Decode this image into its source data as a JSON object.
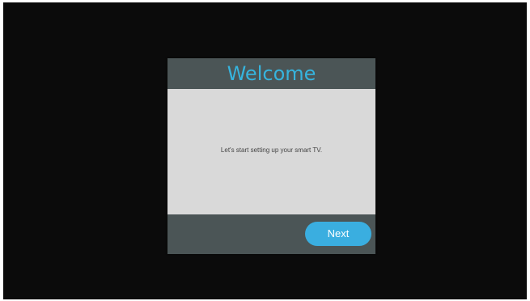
{
  "dialog": {
    "title": "Welcome",
    "message": "Let's start setting up your smart TV.",
    "next_label": "Next"
  },
  "colors": {
    "accent": "#36b4de",
    "button": "#3aaee0",
    "header": "#4b5556",
    "body": "#d9d9d9",
    "background": "#0b0b0b"
  }
}
